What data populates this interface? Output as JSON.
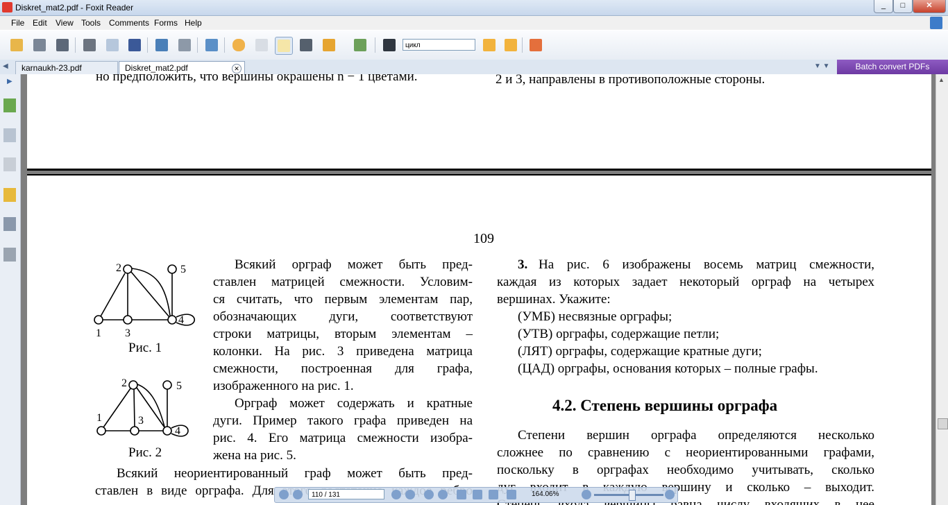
{
  "window": {
    "title": "Diskret_mat2.pdf - Foxit Reader",
    "buttons": [
      "_",
      "□",
      "✕"
    ]
  },
  "menu": [
    "File",
    "Edit",
    "View",
    "Tools",
    "Comments",
    "Forms",
    "Help"
  ],
  "toolbar": {
    "search_value": "цикл",
    "icons": [
      "open-icon",
      "save-icon",
      "save-all-icon",
      "print-icon",
      "email-icon",
      "facebook-icon",
      "monitor-icon",
      "collect-icon",
      "extract-icon",
      "hand-icon",
      "select-icon",
      "text-select-icon",
      "snapshot-icon",
      "rms-icon",
      "sign-icon",
      "find-icon",
      "search-prev-icon",
      "search-next-icon",
      "highlight-icon"
    ]
  },
  "tabs": [
    {
      "label": "karnaukh-23.pdf",
      "active": false
    },
    {
      "label": "Diskret_mat2.pdf",
      "active": true
    }
  ],
  "batch_label": "Batch convert PDFs",
  "page_prev": {
    "left_line": "но предположить, что вершины окрашены  n − 1  цветами.",
    "right_line": "2  и  3,  направлены  в противоположные  стороны."
  },
  "page": {
    "number": "109",
    "fig1_caption": "Рис. 1",
    "fig2_caption": "Рис. 2",
    "fig1_labels": [
      "1",
      "2",
      "3",
      "4",
      "5"
    ],
    "fig2_labels": [
      "1",
      "2",
      "3",
      "4",
      "5"
    ],
    "left_col": [
      "Всякий  орграф  может  быть  пред-",
      "ставлен матрицей смежности. Условим-",
      "ся считать, что первым элементам пар,",
      "обозначающих    дуги,    соответствуют",
      "строки  матрицы,  вторым  элементам  –",
      "колонки. На рис. 3 приведена матрица",
      "смежности,   построенная   для   графа,",
      "изображенного на  рис. 1.",
      "Орграф может содержать и кратные",
      "дуги. Пример такого графа приведен на",
      "рис. 4. Его матрица смежности изобра-",
      "жена  на  рис. 5.",
      "Всякий  неориентированный  граф  может  быть  пред-",
      "ставлен в виде орграфа. Для этого достаточно каждое ребро"
    ],
    "right_col": {
      "item_num": "3.",
      "lines": [
        "На рис. 6 изображены восемь матриц смежности,",
        "каждая из которых задает некоторый орграф на четырех",
        "вершинах. Укажите:",
        "(УМБ) несвязные  орграфы;",
        "(УТВ) орграфы,  содержащие  петли;",
        "(ЛЯТ) орграфы,  содержащие  кратные  дуги;",
        "(ЦАД) орграфы, основания которых – полные графы."
      ],
      "heading": "4.2. Степень  вершины  орграфа",
      "para": [
        "Степени  вершин  орграфа  определяются  несколько",
        "сложнее по сравнению с неориентированными графами,",
        "поскольку в орграфах необходимо учитывать, сколько",
        "дуг входит в каждую вершину и сколько – выходит.",
        "Степень  входа вершины равна числу входящих в нее"
      ]
    }
  },
  "navbar": {
    "page_field": "110 / 131",
    "zoom": "164.06%"
  }
}
